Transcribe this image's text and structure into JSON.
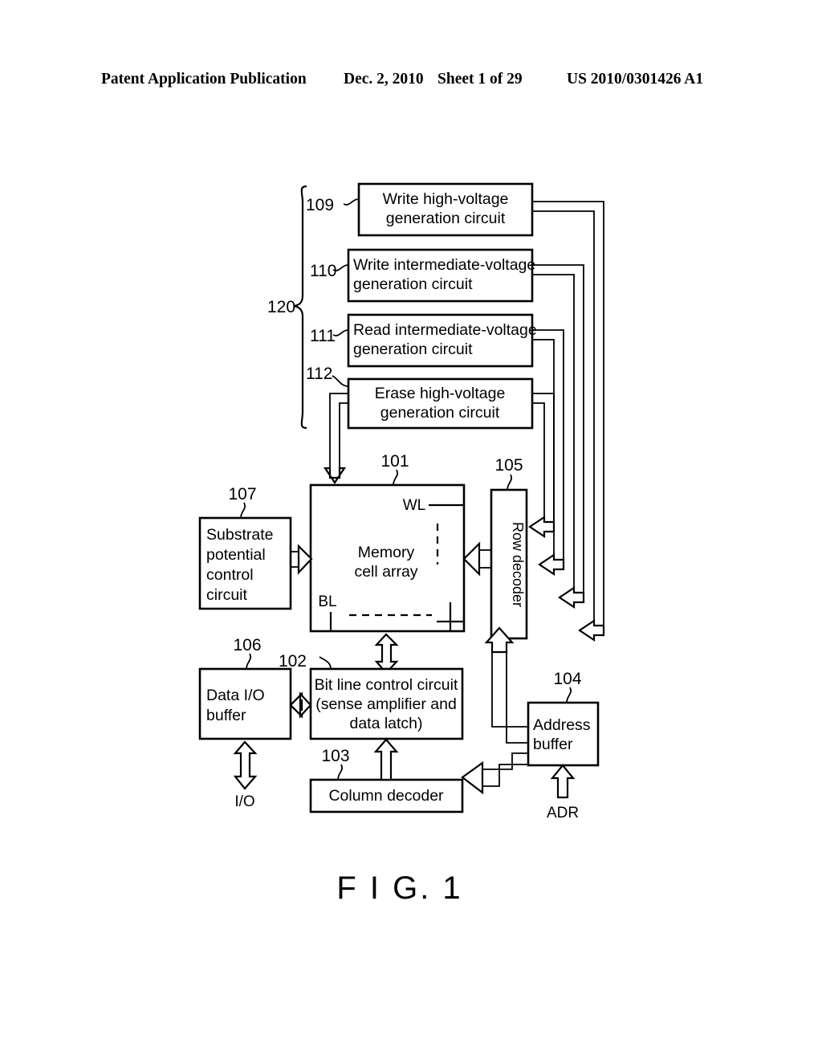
{
  "header": {
    "publication": "Patent Application Publication",
    "date": "Dec. 2, 2010",
    "sheet": "Sheet 1 of 29",
    "number": "US 2010/0301426 A1"
  },
  "figure": {
    "caption": "F I G. 1",
    "group_label": "120",
    "blocks": [
      {
        "id": "109",
        "ref": "109",
        "line1": "Write high-voltage",
        "line2": "generation circuit",
        "align": "center"
      },
      {
        "id": "110",
        "ref": "110",
        "line1": "Write intermediate-voltage",
        "line2": "generation circuit",
        "align": "left"
      },
      {
        "id": "111",
        "ref": "111",
        "line1": "Read intermediate-voltage",
        "line2": "generation circuit",
        "align": "left"
      },
      {
        "id": "112",
        "ref": "112",
        "line1": "Erase high-voltage",
        "line2": "generation circuit",
        "align": "center"
      }
    ],
    "memory_array": {
      "ref": "101",
      "line1": "Memory",
      "line2": "cell array",
      "wl_label": "WL",
      "bl_label": "BL"
    },
    "row_decoder": {
      "ref": "105",
      "label": "Row decoder"
    },
    "substrate": {
      "ref": "107",
      "lines": [
        "Substrate",
        "potential",
        "control",
        "circuit"
      ]
    },
    "data_io_buffer": {
      "ref": "106",
      "line1": "Data I/O",
      "line2": "buffer"
    },
    "bit_line_control": {
      "ref": "102",
      "line1": "Bit line control circuit",
      "line2": "(sense amplifier and",
      "line3": "data latch)"
    },
    "column_decoder": {
      "ref": "103",
      "label": "Column decoder"
    },
    "address_buffer": {
      "ref": "104",
      "line1": "Address",
      "line2": "buffer"
    },
    "signals": {
      "io": "I/O",
      "adr": "ADR"
    }
  },
  "colors": {
    "ink": "#000000",
    "paper": "#ffffff"
  }
}
